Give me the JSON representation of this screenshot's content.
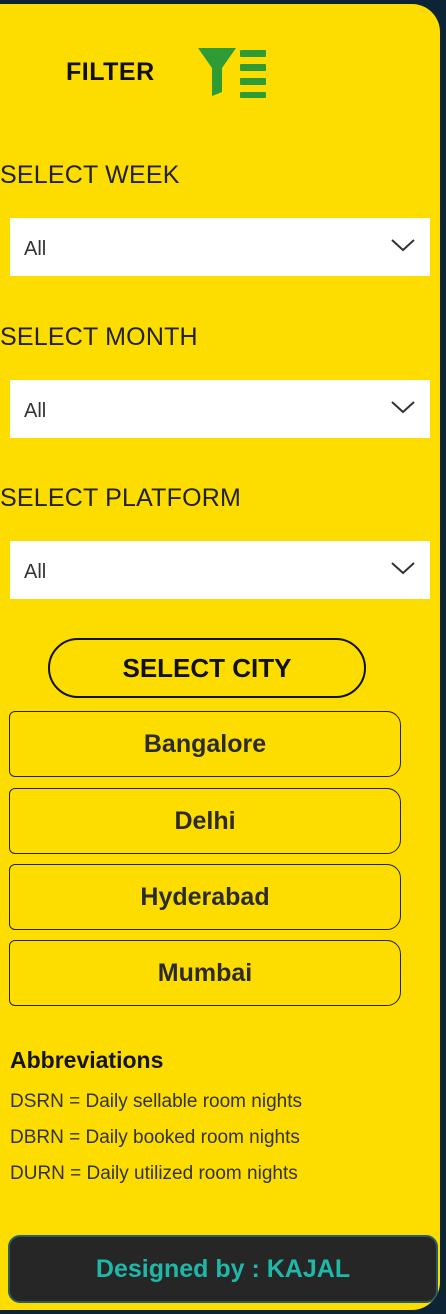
{
  "filter": {
    "title": "FILTER",
    "icon": "filter-icon"
  },
  "week": {
    "label": "SELECT WEEK",
    "value": "All"
  },
  "month": {
    "label": "SELECT MONTH",
    "value": "All"
  },
  "platform": {
    "label": "SELECT PLATFORM",
    "value": "All"
  },
  "city": {
    "title": "SELECT CITY",
    "options": [
      "Bangalore",
      "Delhi",
      "Hyderabad",
      "Mumbai"
    ]
  },
  "abbreviations": {
    "title": "Abbreviations",
    "lines": [
      "DSRN = Daily sellable room nights",
      "DBRN = Daily booked room nights",
      "DURN = Daily utilized room nights"
    ]
  },
  "footer": {
    "text": "Designed by : KAJAL"
  },
  "colors": {
    "panel": "#fddc00",
    "background": "#0d2436",
    "filter_icon": "#2e9b35",
    "footer_bg": "#262626",
    "footer_text": "#1fb8a8"
  }
}
